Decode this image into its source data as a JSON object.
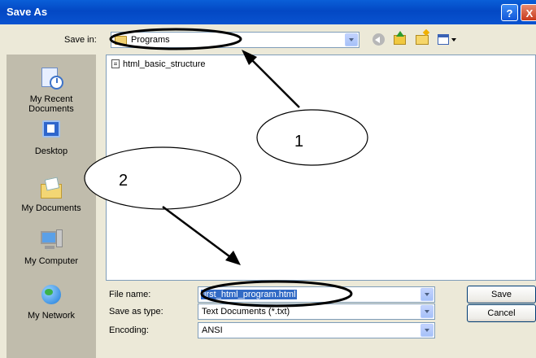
{
  "window": {
    "title": "Save As",
    "help_button": "?",
    "close_button": "X"
  },
  "save_in": {
    "label": "Save in:",
    "value": "Programs"
  },
  "toolbar_icons": [
    "back-icon",
    "up-folder-icon",
    "new-folder-icon",
    "views-menu-icon"
  ],
  "places": [
    {
      "label": "My Recent Documents",
      "icon": "recent-documents-icon"
    },
    {
      "label": "Desktop",
      "icon": "desktop-icon"
    },
    {
      "label": "My Documents",
      "icon": "my-documents-icon"
    },
    {
      "label": "My Computer",
      "icon": "my-computer-icon"
    },
    {
      "label": "My Network",
      "icon": "my-network-icon"
    }
  ],
  "files": [
    {
      "name": "html_basic_structure"
    }
  ],
  "form": {
    "file_name_label": "File name:",
    "file_name_value": "first_html_program.html",
    "save_as_type_label": "Save as type:",
    "save_as_type_value": "Text Documents (*.txt)",
    "encoding_label": "Encoding:",
    "encoding_value": "ANSI"
  },
  "buttons": {
    "save": "Save",
    "cancel": "Cancel"
  },
  "annotations": {
    "callout1": "1",
    "callout2": "2"
  }
}
